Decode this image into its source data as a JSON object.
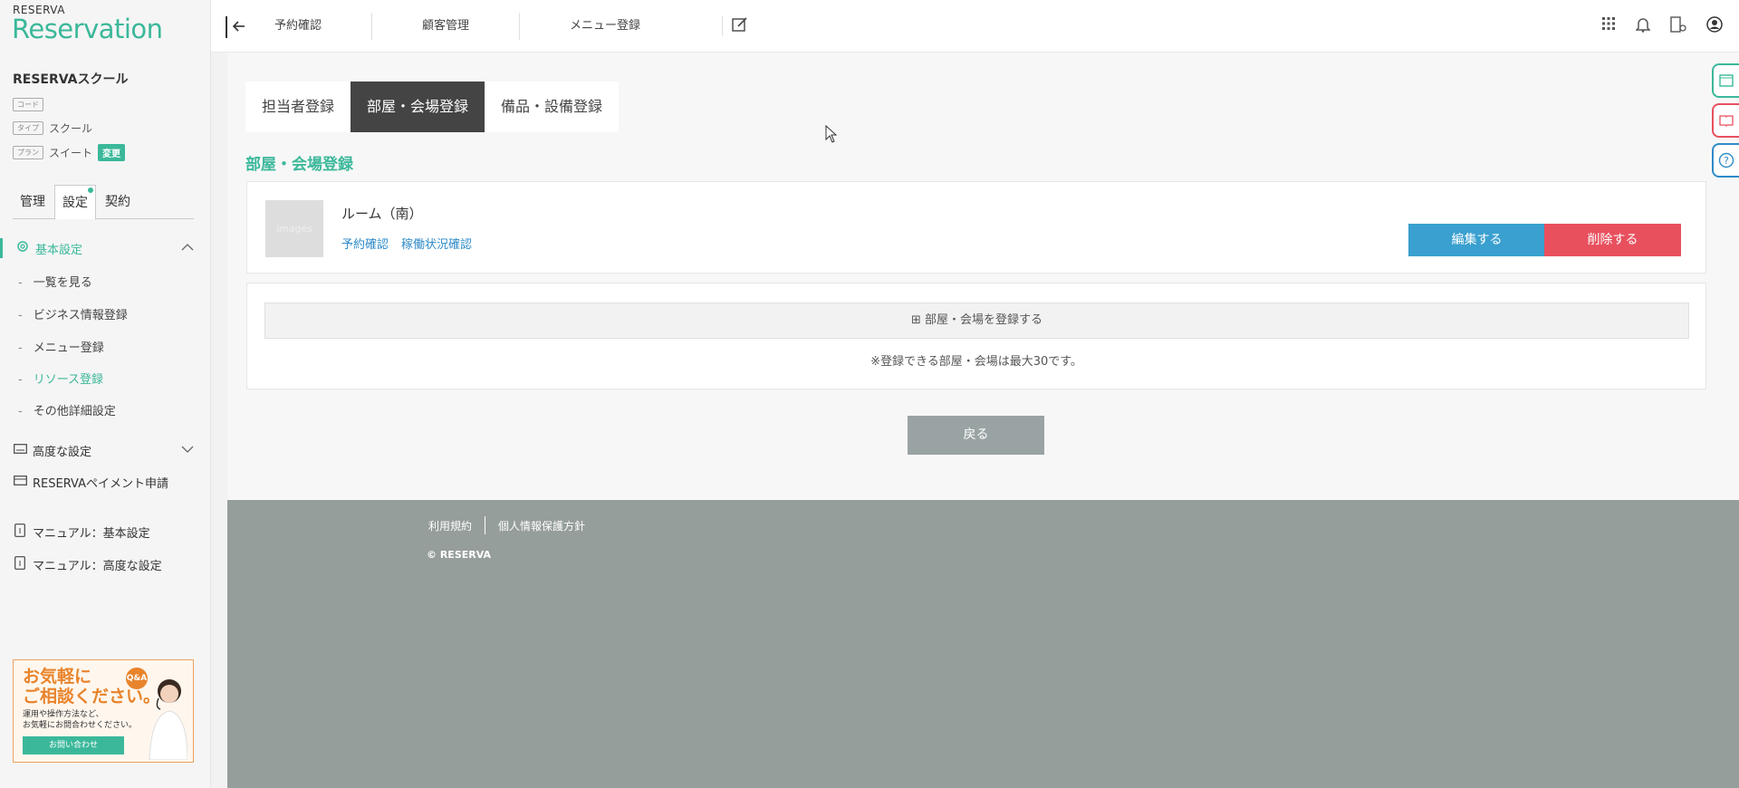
{
  "brand": {
    "small": "RESERVA",
    "big": "Reservation"
  },
  "sidebar": {
    "school_name": "RESERVAスクール",
    "meta": [
      {
        "tag": "コード",
        "value": ""
      },
      {
        "tag": "タイプ",
        "value": "スクール"
      },
      {
        "tag": "プラン",
        "value": "スイート",
        "badge": "変更"
      }
    ],
    "tabs": [
      "管理",
      "設定",
      "契約"
    ],
    "sections": {
      "basic": "基本設定",
      "advanced": "高度な設定",
      "payment": "RESERVAペイメント申請",
      "manual_basic": "マニュアル：基本設定",
      "manual_advanced": "マニュアル：高度な設定"
    },
    "sub_items": [
      "一覧を見る",
      "ビジネス情報登録",
      "メニュー登録",
      "リソース登録",
      "その他詳細設定"
    ],
    "banner": {
      "line1": "お気軽に",
      "line2": "ご相談ください。",
      "desc1": "運用や操作方法など、",
      "desc2": "お気軽にお問合わせください。",
      "button": "お問い合わせ",
      "qa": "Q&A"
    }
  },
  "topnav": [
    "予約確認",
    "顧客管理",
    "メニュー登録"
  ],
  "tabs": [
    "担当者登録",
    "部屋・会場登録",
    "備品・設備登録"
  ],
  "section_title": "部屋・会場登録",
  "resource": {
    "thumb": "images",
    "name": "ルーム（南）",
    "links": [
      "予約確認",
      "稼働状況確認"
    ],
    "edit": "編集する",
    "delete": "削除する"
  },
  "add_button": "⊞ 部屋・会場を登録する",
  "note": "※登録できる部屋・会場は最大30です。",
  "back": "戻る",
  "footer": {
    "links": [
      "利用規約",
      "個人情報保護方針"
    ],
    "copyright": "© RESERVA"
  }
}
